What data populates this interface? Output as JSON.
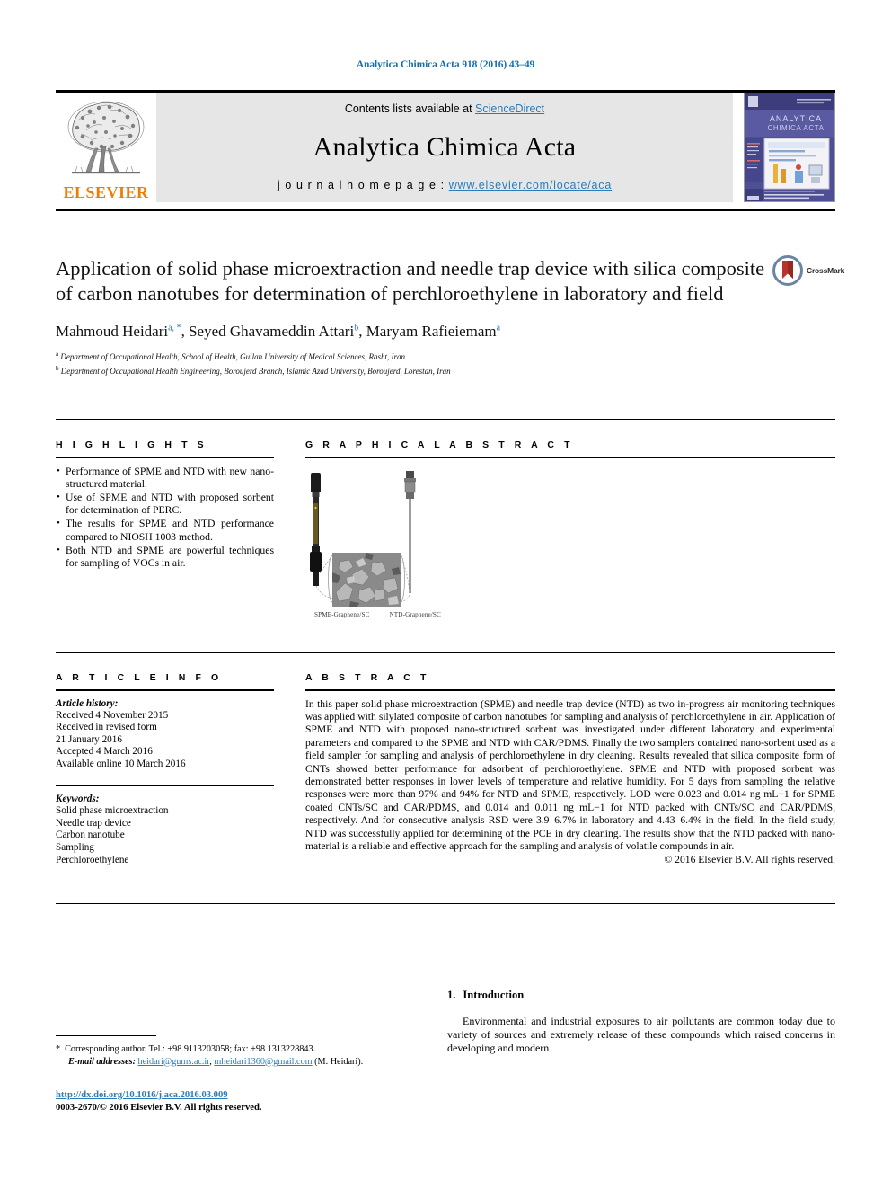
{
  "running_head": "Analytica Chimica Acta 918 (2016) 43–49",
  "masthead": {
    "contents_prefix": "Contents lists available at ",
    "sciencedirect": "ScienceDirect",
    "journal_name": "Analytica Chimica Acta",
    "homepage_label": "j o u r n a l   h o m e p a g e :  ",
    "homepage_url": "www.elsevier.com/locate/aca",
    "publisher": "ELSEVIER",
    "cover_title_line1": "ANALYTICA",
    "cover_title_line2": "CHIMICA ACTA"
  },
  "article": {
    "title": "Application of solid phase microextraction and needle trap device with silica composite of carbon nanotubes for determination of perchloroethylene in laboratory and field",
    "authors_html": "Mahmoud Heidari, Seyed Ghavameddin Attari, Maryam Rafieiemam",
    "authors": [
      {
        "name": "Mahmoud Heidari",
        "marks": "a, *"
      },
      {
        "name": "Seyed Ghavameddin Attari",
        "marks": "b"
      },
      {
        "name": "Maryam Rafieiemam",
        "marks": "a"
      }
    ],
    "affiliations": [
      {
        "mark": "a",
        "text": "Department of Occupational Health, School of Health, Guilan University of Medical Sciences, Rasht, Iran"
      },
      {
        "mark": "b",
        "text": "Department of Occupational Health Engineering, Boroujerd Branch, Islamic Azad University, Boroujerd, Lorestan, Iran"
      }
    ],
    "crossmark_label": "CrossMark"
  },
  "highlights": {
    "heading": "H I G H L I G H T S",
    "items": [
      "Performance of SPME and NTD with new nano-structured material.",
      "Use of SPME and NTD with proposed sorbent for determination of PERC.",
      "The results for SPME and NTD performance compared to NIOSH 1003 method.",
      "Both NTD and SPME are powerful techniques for sampling of VOCs in air."
    ]
  },
  "graphical_abstract": {
    "heading": "G R A P H I C A L   A B S T R A C T",
    "caption_left": "SPME-Graphene/SC",
    "caption_right": "NTD-Graphene/SC"
  },
  "article_info": {
    "heading": "A R T I C L E   I N F O",
    "history_label": "Article history:",
    "history": [
      "Received 4 November 2015",
      "Received in revised form",
      "21 January 2016",
      "Accepted 4 March 2016",
      "Available online 10 March 2016"
    ],
    "keywords_label": "Keywords:",
    "keywords": [
      "Solid phase microextraction",
      "Needle trap device",
      "Carbon nanotube",
      "Sampling",
      "Perchloroethylene"
    ]
  },
  "abstract": {
    "heading": "A B S T R A C T",
    "body": "In this paper solid phase microextraction (SPME) and needle trap device (NTD) as two in-progress air monitoring techniques was applied with silylated composite of carbon nanotubes for sampling and analysis of perchloroethylene in air. Application of SPME and NTD with proposed nano-structured sorbent was investigated under different laboratory and experimental parameters and compared to the SPME and NTD with CAR/PDMS. Finally the two samplers contained nano-sorbent used as a field sampler for sampling and analysis of perchloroethylene in dry cleaning. Results revealed that silica composite form of CNTs showed better performance for adsorbent of perchloroethylene. SPME and NTD with proposed sorbent was demonstrated better responses in lower levels of temperature and relative humidity. For 5 days from sampling the relative responses were more than 97% and 94% for NTD and SPME, respectively. LOD were 0.023 and 0.014 ng mL−1 for SPME coated CNTs/SC and CAR/PDMS, and 0.014 and 0.011 ng mL−1 for NTD packed with CNTs/SC and CAR/PDMS, respectively. And for consecutive analysis RSD were 3.9–6.7% in laboratory and 4.43–6.4% in the field. In the field study, NTD was successfully applied for determining of the PCE in dry cleaning. The results show that the NTD packed with nano-material is a reliable and effective approach for the sampling and analysis of volatile compounds in air.",
    "rights": "© 2016 Elsevier B.V. All rights reserved."
  },
  "introduction": {
    "number": "1.",
    "heading": "Introduction",
    "paragraph": "Environmental and industrial exposures to air pollutants are common today due to variety of sources and extremely release of these compounds which raised concerns in developing and modern"
  },
  "footnote": {
    "star": "*",
    "corresponding": "Corresponding author. Tel.: +98 9113203058; fax: +98 1313228843.",
    "email_label": "E-mail addresses:",
    "email1": "heidari@gums.ac.ir",
    "email2": "mheidari1360@gmail.com",
    "email_suffix": "(M. Heidari).",
    "doi": "http://dx.doi.org/10.1016/j.aca.2016.03.009",
    "issn_line": "0003-2670/© 2016 Elsevier B.V. All rights reserved."
  },
  "colors": {
    "link": "#2b7cb8",
    "runhead": "#1a6ea8",
    "elsevier_orange": "#ef7d00",
    "band_gray": "#e6e6e6"
  }
}
